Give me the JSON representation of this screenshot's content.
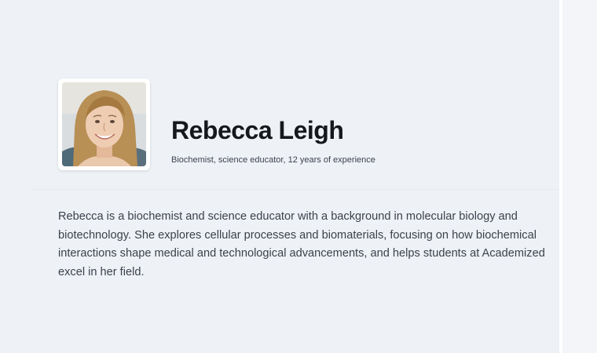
{
  "profile": {
    "name": "Rebecca Leigh",
    "subtitle": "Biochemist, science educator, 12 years of experience",
    "avatar_icon": "person-photo",
    "bio": "Rebecca is a biochemist and science educator with a background in molecular biology and biotechnology. She explores cellular processes and biomaterials, focusing on how biochemical interactions shape medical and technological advancements, and helps students at Academized excel in her field."
  },
  "colors": {
    "background": "#eef1f5",
    "name_text": "#16181d",
    "body_text": "#3b414c"
  }
}
